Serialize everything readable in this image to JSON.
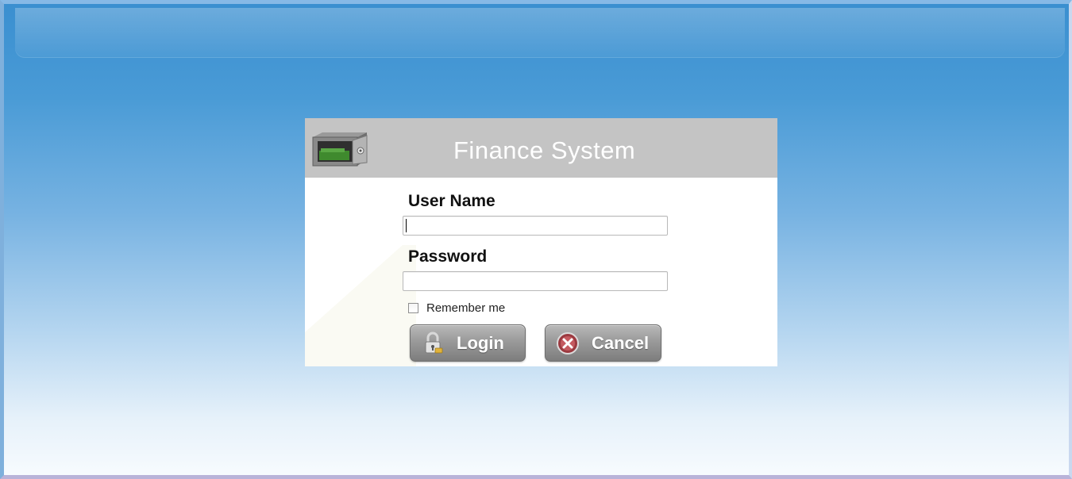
{
  "dialog": {
    "title": "Finance System",
    "header_icon": "safe-icon"
  },
  "form": {
    "username_label": "User Name",
    "username_value": "",
    "password_label": "Password",
    "password_value": "",
    "remember_label": "Remember me",
    "remember_checked": false
  },
  "buttons": {
    "login_label": "Login",
    "login_icon": "padlock-icon",
    "cancel_label": "Cancel",
    "cancel_icon": "cancel-icon"
  },
  "colors": {
    "header_bg": "#c4c4c4",
    "button_gray": "#9a9a9a",
    "background_blue": "#3a8fd0"
  }
}
